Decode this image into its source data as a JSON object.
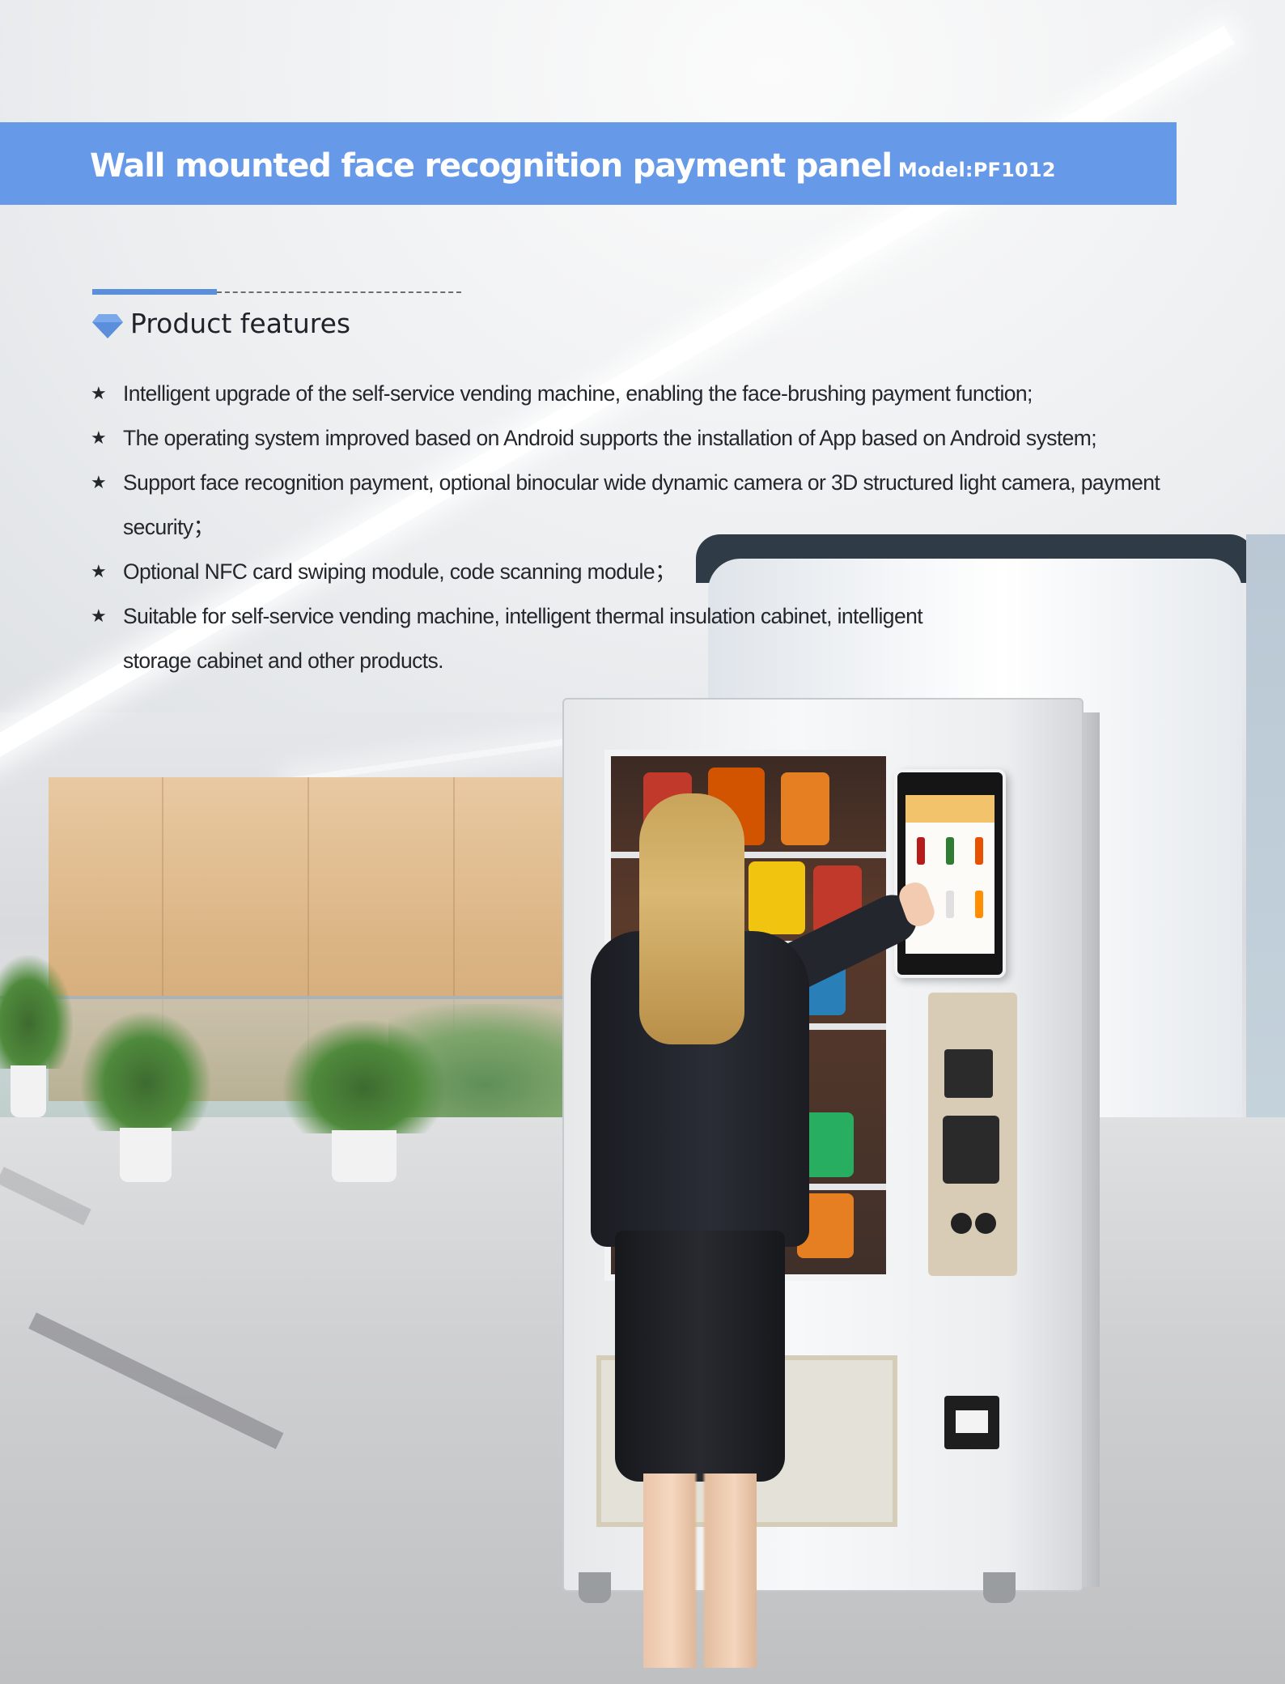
{
  "banner": {
    "title": "Wall mounted face recognition payment panel",
    "model": "Model:PF1012",
    "color": "#6699e8"
  },
  "features": {
    "title": "Product features",
    "icon": "diamond-icon",
    "accent_color": "#5b8fdc",
    "items": [
      "Intelligent upgrade of the self-service vending machine, enabling the face-brushing payment function;",
      "The operating system improved based on Android supports the installation of App based on Android system;",
      "Support face recognition payment, optional binocular wide dynamic camera or 3D structured light camera, payment security；",
      "Optional NFC card swiping module, code scanning module；",
      "Suitable for self-service vending machine, intelligent thermal insulation cabinet, intelligent storage cabinet and other products."
    ],
    "bullet": "★"
  }
}
